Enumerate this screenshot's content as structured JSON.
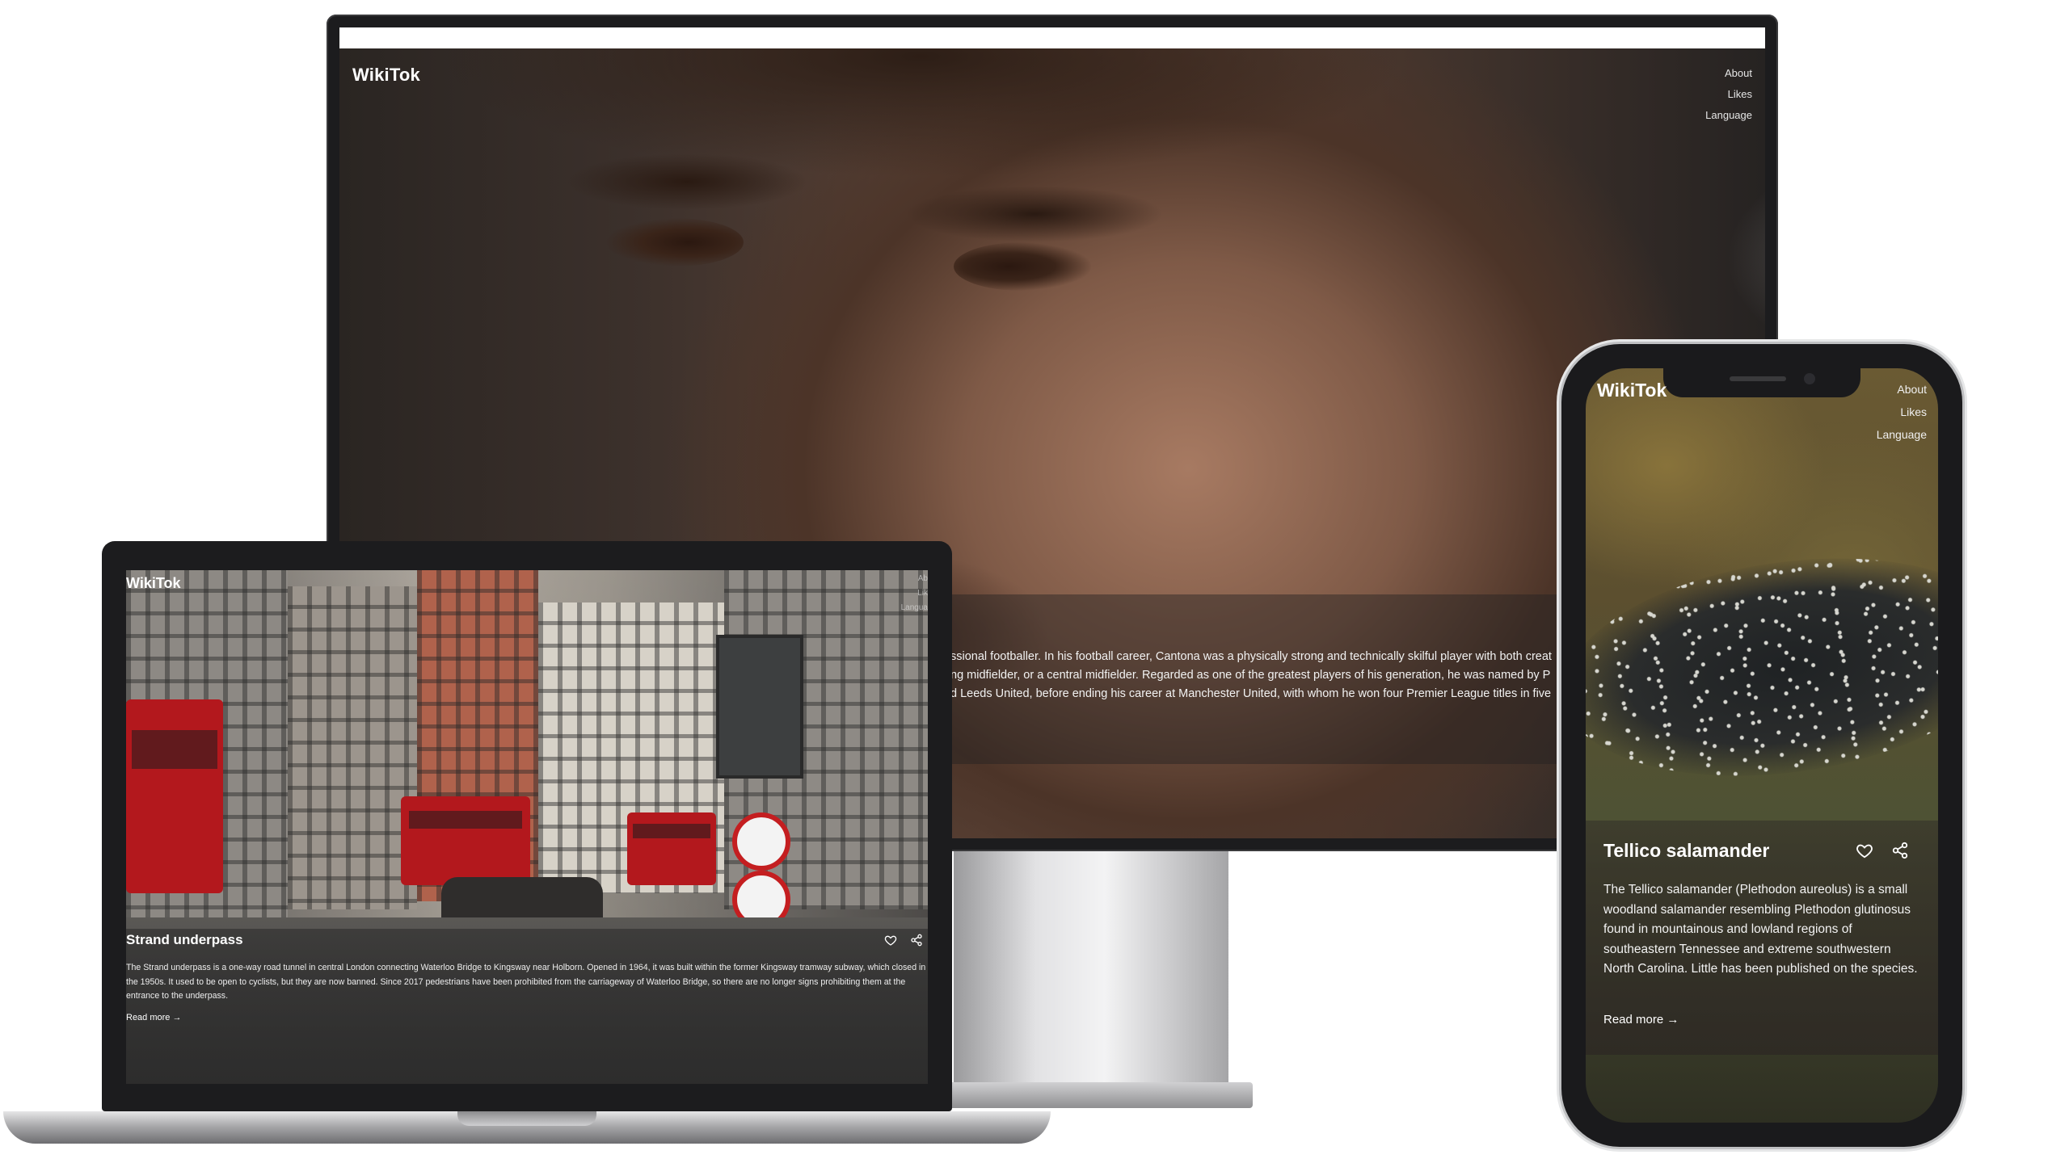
{
  "app": {
    "name": "WikiTok"
  },
  "nav": {
    "about": "About",
    "likes": "Likes",
    "language": "Language"
  },
  "monitor": {
    "description_lines": [
      "ssional footballer. In his football career, Cantona was a physically strong and technically skilful player with both creat",
      "ng midfielder, or a central midfielder. Regarded as one of the greatest players of his generation, he was named by P",
      "d Leeds United, before ending his career at Manchester United, with whom he won four Premier League titles in five"
    ]
  },
  "laptop": {
    "title": "Strand underpass",
    "description": "The Strand underpass is a one-way road tunnel in central London connecting Waterloo Bridge to Kingsway near Holborn. Opened in 1964, it was built within the former Kingsway tramway subway, which closed in the 1950s. It used to be open to cyclists, but they are now banned. Since 2017 pedestrians have been prohibited from the carriageway of Waterloo Bridge, so there are no longer signs prohibiting them at the entrance to the underpass.",
    "read_more": "Read more →",
    "nav_partial": {
      "about": "Ab",
      "likes": "Lik",
      "language": "Langua"
    }
  },
  "phone": {
    "title": "Tellico salamander",
    "description": "The Tellico salamander (Plethodon aureolus) is a small woodland salamander resembling Plethodon glutinosus found in mountainous and lowland regions of southeastern Tennessee and extreme southwestern North Carolina. Little has been published on the species.",
    "read_more": "Read more →"
  },
  "icons": {
    "like": "heart-icon",
    "share": "share-icon"
  },
  "colors": {
    "text": "#ffffff",
    "overlay": "#2a2626",
    "device_frame": "#1c1c1e"
  }
}
